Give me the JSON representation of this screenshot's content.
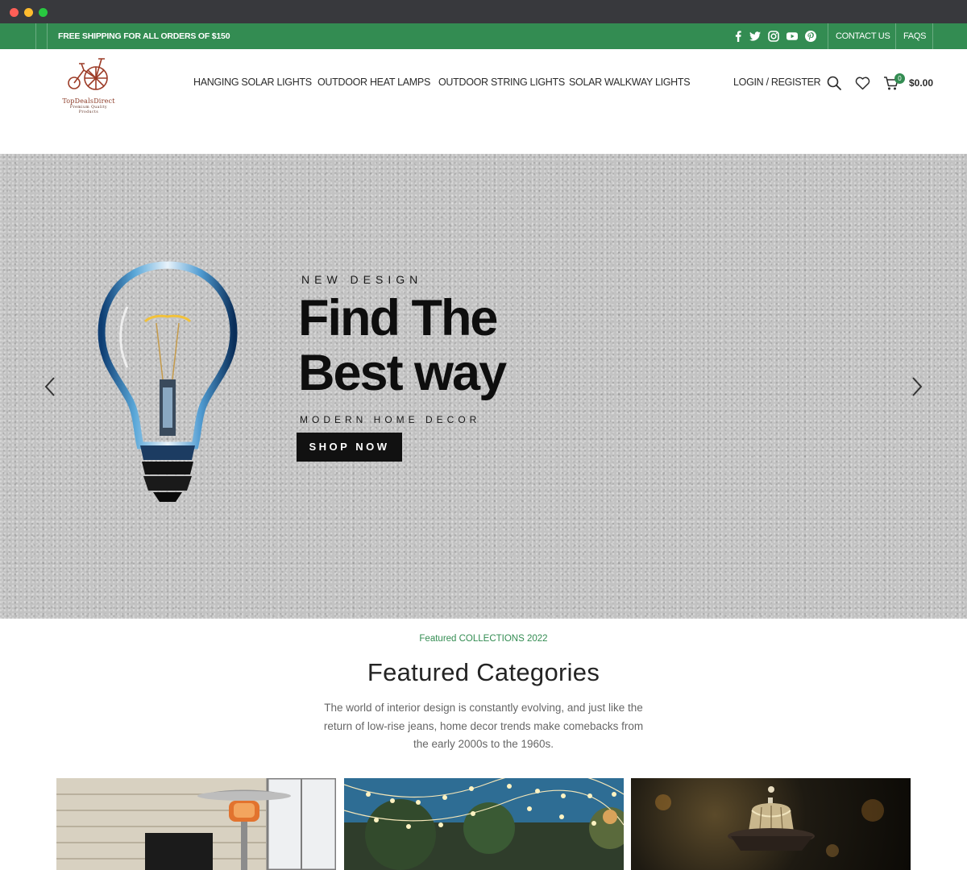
{
  "topbar": {
    "shipping_text": "FREE SHIPPING FOR ALL ORDERS OF $150",
    "social_icons": [
      "facebook-icon",
      "twitter-icon",
      "instagram-icon",
      "youtube-icon",
      "pinterest-icon"
    ],
    "links": {
      "contact": "CONTACT US",
      "faqs": "FAQS"
    },
    "color": "#338c52"
  },
  "header": {
    "logo": {
      "brand": "TopDealsDirect",
      "tagline_1": "Premium Quality",
      "tagline_2": "Products"
    },
    "nav": [
      {
        "label": "HANGING SOLAR LIGHTS"
      },
      {
        "label": "OUTDOOR HEAT LAMPS"
      },
      {
        "label": "OUTDOOR STRING LIGHTS"
      },
      {
        "label": "SOLAR WALKWAY LIGHTS"
      }
    ],
    "login": "LOGIN / REGISTER",
    "cart": {
      "count": "0",
      "total": "$0.00"
    }
  },
  "hero": {
    "eyebrow": "NEW DESIGN",
    "headline_line1": "Find The",
    "headline_line2": "Best way",
    "subtitle": "MODERN HOME DECOR",
    "cta": "SHOP NOW"
  },
  "featured": {
    "eyebrow": "Featured COLLECTIONS 2022",
    "title": "Featured Categories",
    "description": "The world of interior design is constantly evolving, and just like the return of low-rise jeans, home decor trends make comebacks from the early 2000s to the 1960s."
  }
}
